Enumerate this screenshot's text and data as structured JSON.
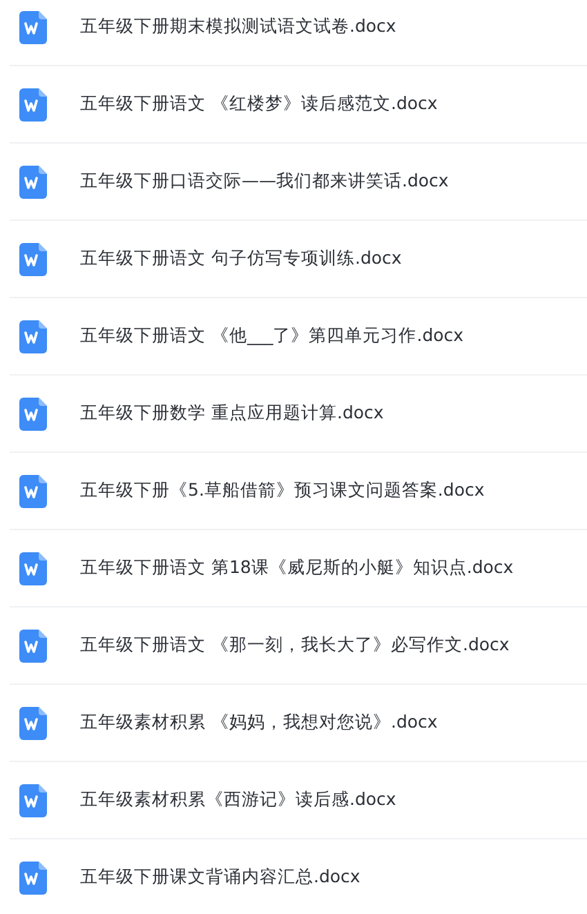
{
  "files": [
    {
      "name": "五年级下册期末模拟测试语文试卷.docx"
    },
    {
      "name": "五年级下册语文 《红楼梦》读后感范文.docx"
    },
    {
      "name": "五年级下册口语交际——我们都来讲笑话.docx"
    },
    {
      "name": "五年级下册语文 句子仿写专项训练.docx"
    },
    {
      "name": "五年级下册语文 《他___了》第四单元习作.docx"
    },
    {
      "name": "五年级下册数学 重点应用题计算.docx"
    },
    {
      "name": "五年级下册《5.草船借箭》预习课文问题答案.docx"
    },
    {
      "name": "五年级下册语文 第18课《威尼斯的小艇》知识点.docx"
    },
    {
      "name": "五年级下册语文 《那一刻，我长大了》必写作文.docx"
    },
    {
      "name": "五年级素材积累 《妈妈，我想对您说》.docx"
    },
    {
      "name": "五年级素材积累《西游记》读后感.docx"
    },
    {
      "name": "五年级下册课文背诵内容汇总.docx"
    }
  ]
}
